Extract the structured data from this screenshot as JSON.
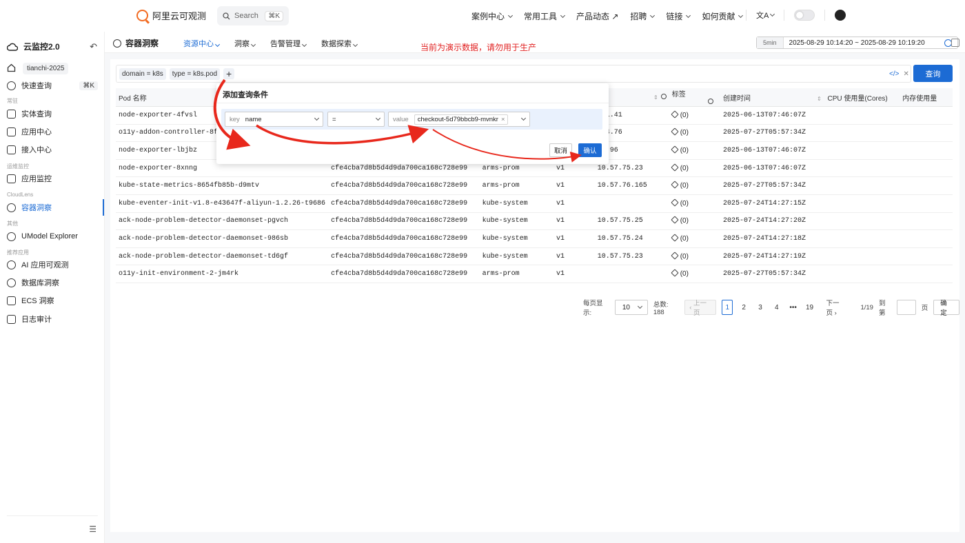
{
  "topnav": {
    "brand": "阿里云可观测",
    "search_placeholder": "Search",
    "search_kbd": "⌘K",
    "menu": [
      {
        "label": "案例中心",
        "dropdown": true
      },
      {
        "label": "常用工具",
        "dropdown": true
      },
      {
        "label": "产品动态 ↗",
        "dropdown": false
      },
      {
        "label": "招聘",
        "dropdown": true
      },
      {
        "label": "链接",
        "dropdown": true
      },
      {
        "label": "如何贡献",
        "dropdown": true
      }
    ],
    "translate_icon": "文A"
  },
  "sidebar": {
    "title": "云监控2.0",
    "back_icon": "↶",
    "tenant": "tianchi-2025",
    "quick_query": {
      "label": "快速查询",
      "kbd": "⌘K"
    },
    "groups": {
      "g1": "常驻",
      "g2": "运维监控",
      "g3": "CloudLens",
      "g4": "其他",
      "g5": "推荐应用"
    },
    "items": {
      "entity": "实体查询",
      "app_center": "应用中心",
      "access": "接入中心",
      "app_monitor": "应用监控",
      "container": "容器洞察",
      "umodel": "UModel Explorer",
      "ai_app": "AI 应用可观测",
      "db": "数据库洞察",
      "ecs": "ECS 洞察",
      "audit": "日志审计"
    },
    "collapse_icon": "☰"
  },
  "header": {
    "title": "容器洞察",
    "tabs": [
      "资源中心",
      "洞察",
      "告警管理",
      "数据探索"
    ],
    "warning": "当前为演示数据，请勿用于生产",
    "time_duration": "5min",
    "time_range": "2025-08-29 10:14:20 ~ 2025-08-29 10:19:20"
  },
  "filters": {
    "chips": [
      "domain = k8s",
      "type = k8s.pod"
    ],
    "add": "+",
    "code_icon": "</>",
    "clear_icon": "✕",
    "query_label": "查询"
  },
  "table": {
    "columns": [
      "Pod 名称",
      "",
      "",
      "",
      "",
      "标签",
      "创建时间",
      "CPU 使用量(Cores)",
      "内存使用量"
    ],
    "rows": [
      {
        "name": "node-exporter-4fvsl",
        "uid": "",
        "ns": "",
        "ver": "",
        "ip": "241.41",
        "tags": "(0)",
        "created": "2025-06-13T07:46:07Z"
      },
      {
        "name": "o11y-addon-controller-8f7",
        "uid": "",
        "ns": "",
        "ver": "",
        "ip": "244.76",
        "tags": "(0)",
        "created": "2025-07-27T05:57:34Z"
      },
      {
        "name": "node-exporter-lbjbz",
        "uid": "",
        "ns": "",
        "ver": "",
        "ip": "75.96",
        "tags": "(0)",
        "created": "2025-06-13T07:46:07Z"
      },
      {
        "name": "node-exporter-8xnng",
        "uid": "cfe4cba7d8b5d4d9da700ca168c728e99",
        "ns": "arms-prom",
        "ver": "v1",
        "ip": "10.57.75.23",
        "tags": "(0)",
        "created": "2025-06-13T07:46:07Z"
      },
      {
        "name": "kube-state-metrics-8654fb85b-d9mtv",
        "uid": "cfe4cba7d8b5d4d9da700ca168c728e99",
        "ns": "arms-prom",
        "ver": "v1",
        "ip": "10.57.76.165",
        "tags": "(0)",
        "created": "2025-07-27T05:57:34Z"
      },
      {
        "name": "kube-eventer-init-v1.8-e43647f-aliyun-1.2.26-t9686",
        "uid": "cfe4cba7d8b5d4d9da700ca168c728e99",
        "ns": "kube-system",
        "ver": "v1",
        "ip": "",
        "tags": "(0)",
        "created": "2025-07-24T14:27:15Z"
      },
      {
        "name": "ack-node-problem-detector-daemonset-pgvch",
        "uid": "cfe4cba7d8b5d4d9da700ca168c728e99",
        "ns": "kube-system",
        "ver": "v1",
        "ip": "10.57.75.25",
        "tags": "(0)",
        "created": "2025-07-24T14:27:20Z"
      },
      {
        "name": "ack-node-problem-detector-daemonset-986sb",
        "uid": "cfe4cba7d8b5d4d9da700ca168c728e99",
        "ns": "kube-system",
        "ver": "v1",
        "ip": "10.57.75.24",
        "tags": "(0)",
        "created": "2025-07-24T14:27:18Z"
      },
      {
        "name": "ack-node-problem-detector-daemonset-td6gf",
        "uid": "cfe4cba7d8b5d4d9da700ca168c728e99",
        "ns": "kube-system",
        "ver": "v1",
        "ip": "10.57.75.23",
        "tags": "(0)",
        "created": "2025-07-24T14:27:19Z"
      },
      {
        "name": "o11y-init-environment-2-jm4rk",
        "uid": "cfe4cba7d8b5d4d9da700ca168c728e99",
        "ns": "arms-prom",
        "ver": "v1",
        "ip": "",
        "tags": "(0)",
        "created": "2025-07-27T05:57:34Z"
      }
    ]
  },
  "pagination": {
    "per_page_label": "每页显示:",
    "per_page": "10",
    "total": "总数: 188",
    "prev": "上一页",
    "pages": [
      "1",
      "2",
      "3",
      "4",
      "•••",
      "19"
    ],
    "next": "下一页",
    "page_info": "1/19",
    "goto_label": "到第",
    "page_unit": "页",
    "confirm": "确定"
  },
  "popover": {
    "title": "添加查询条件",
    "key_label": "key",
    "key_value": "name",
    "operator": "=",
    "value_label": "value",
    "value_chip": "checkout-5d79bbcb9-mvnkr",
    "cancel": "取消",
    "confirm": "确认"
  },
  "colors": {
    "accent": "#1c6bd4",
    "warning": "#e02020",
    "brand": "#f26b21"
  }
}
